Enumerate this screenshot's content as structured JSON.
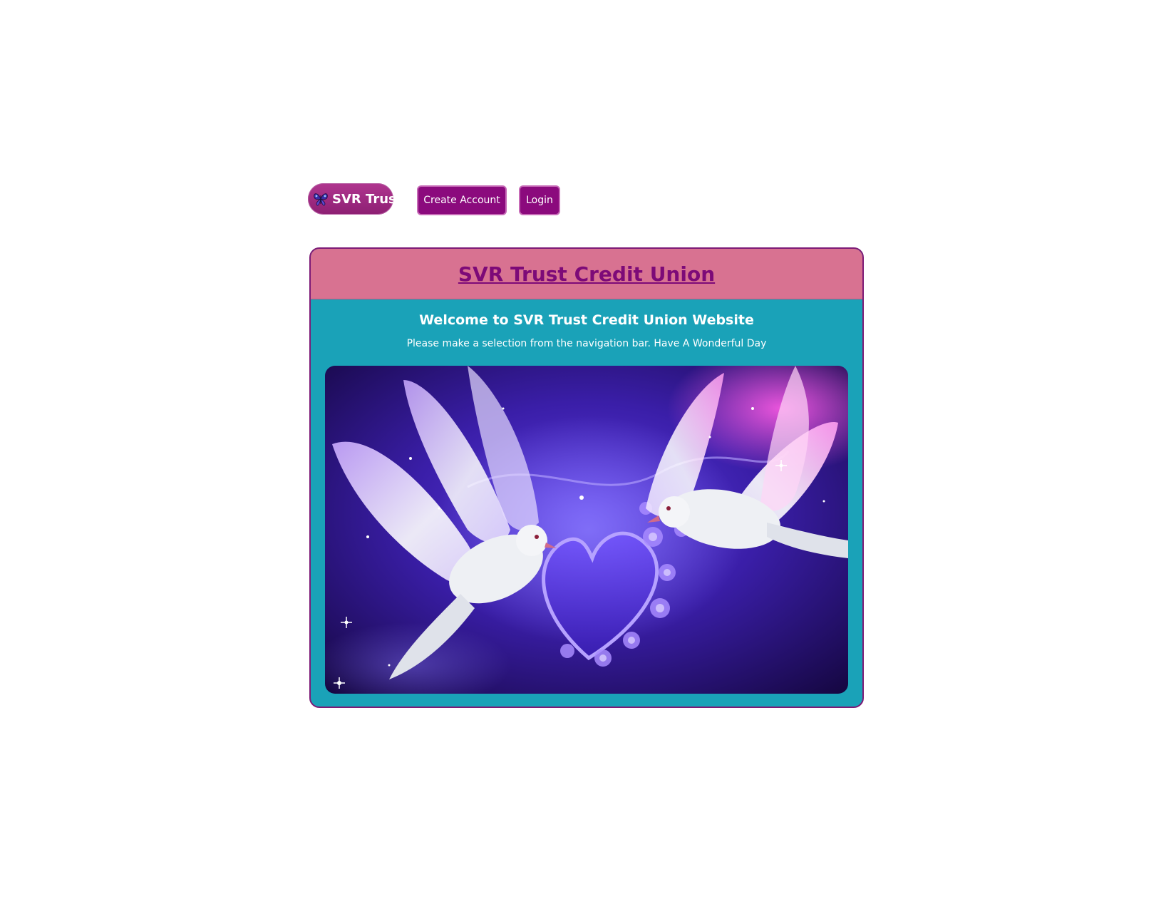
{
  "nav": {
    "brand_label": "SVR Trust",
    "create_account_label": "Create Account",
    "login_label": "Login"
  },
  "card": {
    "title": "SVR Trust Credit Union",
    "welcome": "Welcome to SVR Trust Credit Union Website",
    "subtext": "Please make a selection from the navigation bar. Have A Wonderful Day"
  },
  "colors": {
    "brand_pill": "#9c2a82",
    "nav_button": "#8b0a7d",
    "card_header": "#d87291",
    "card_body": "#1aa2b8",
    "title_text": "#7d0a78"
  },
  "icons": {
    "brand": "butterfly-icon"
  }
}
